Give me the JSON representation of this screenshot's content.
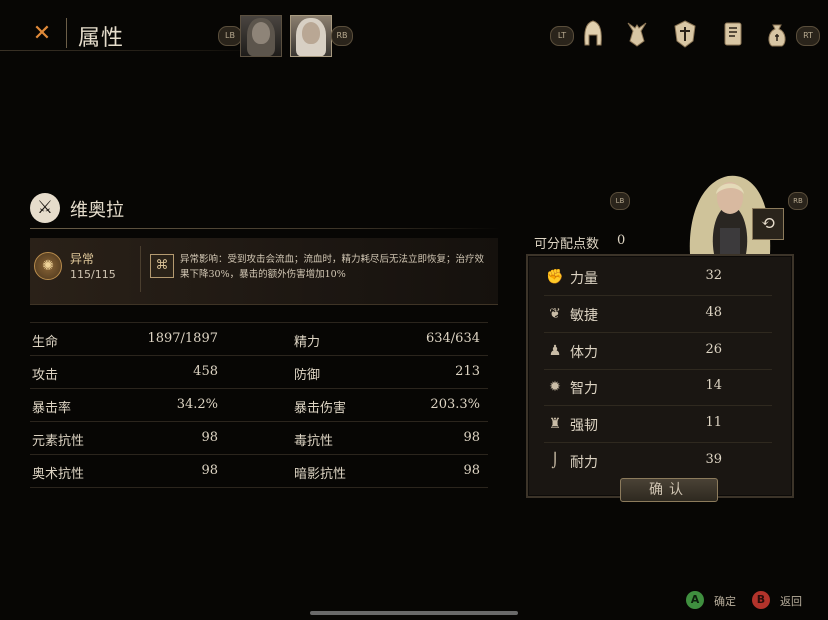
{
  "header": {
    "close_icon": "close-x-icon",
    "title": "属性",
    "lb": "LB",
    "rb": "RB"
  },
  "top_menu": {
    "lt": "LT",
    "rt": "RT",
    "icons": [
      "helmet-icon",
      "creature-icon",
      "shield-emblem-icon",
      "book-icon",
      "money-bag-icon"
    ]
  },
  "character": {
    "name": "维奥拉",
    "status": {
      "name": "异常",
      "value": "115/115",
      "effect": "异常影响：受到攻击会流血；流血时，精力耗尽后无法立即恢复；治疗效果下降30%，暴击的额外伤害增加10%"
    },
    "stats": [
      {
        "l1": "生命",
        "v1": "1897/1897",
        "l2": "精力",
        "v2": "634/634"
      },
      {
        "l1": "攻击",
        "v1": "458",
        "l2": "防御",
        "v2": "213"
      },
      {
        "l1": "暴击率",
        "v1": "34.2%",
        "l2": "暴击伤害",
        "v2": "203.3%"
      },
      {
        "l1": "元素抗性",
        "v1": "98",
        "l2": "毒抗性",
        "v2": "98"
      },
      {
        "l1": "奥术抗性",
        "v1": "98",
        "l2": "暗影抗性",
        "v2": "98"
      }
    ]
  },
  "attributes": {
    "lb": "LB",
    "rb": "RB",
    "points_label": "可分配点数",
    "points_value": "0",
    "items": [
      {
        "label": "力量",
        "value": "32",
        "icon": "fist-icon"
      },
      {
        "label": "敏捷",
        "value": "48",
        "icon": "feather-icon"
      },
      {
        "label": "体力",
        "value": "26",
        "icon": "person-icon"
      },
      {
        "label": "智力",
        "value": "14",
        "icon": "sun-icon"
      },
      {
        "label": "强韧",
        "value": "11",
        "icon": "anvil-icon"
      },
      {
        "label": "耐力",
        "value": "39",
        "icon": "boot-icon"
      }
    ],
    "confirm": "确认"
  },
  "footer": {
    "a_key": "A",
    "a_label": "确定",
    "b_key": "B",
    "b_label": "返回"
  },
  "colors": {
    "accent": "#e08a3a",
    "a_button": "#3f8f3f",
    "b_button": "#b2332b"
  }
}
